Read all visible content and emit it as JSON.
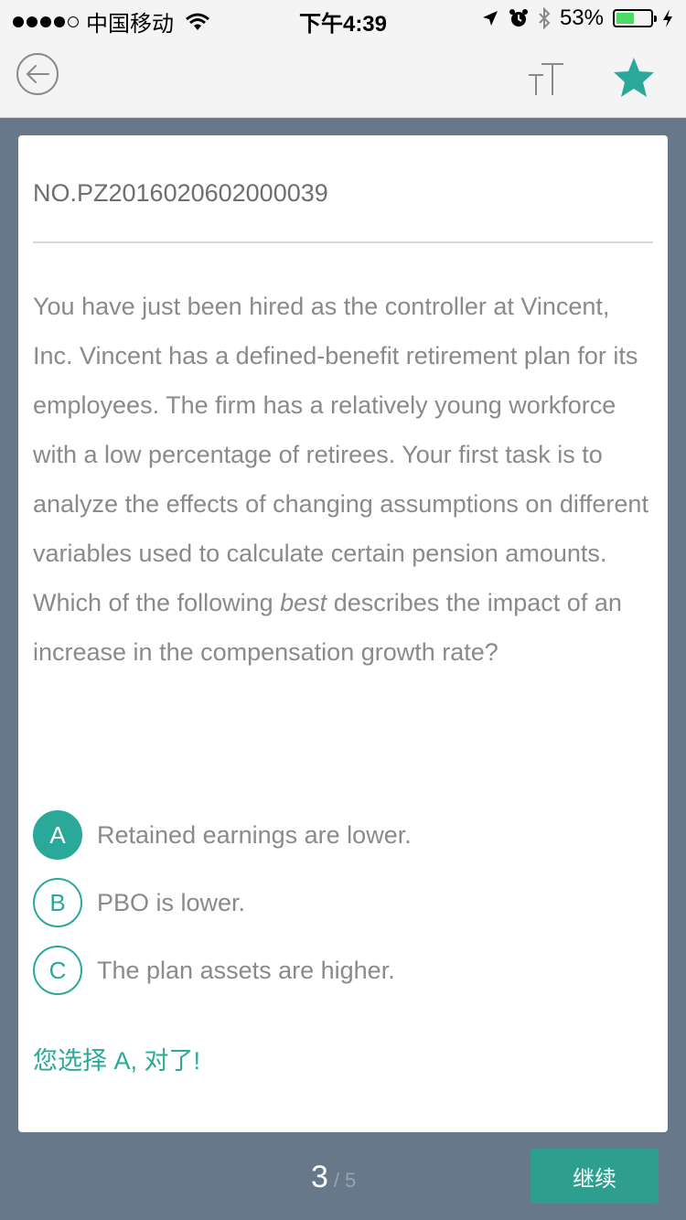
{
  "status_bar": {
    "carrier": "中国移动",
    "time": "下午4:39",
    "battery": "53%"
  },
  "question": {
    "id": "NO.PZ2016020602000039",
    "stem": "You have just been hired as the controller at Vincent, Inc. Vincent has a defined-benefit retirement plan for its employees. The firm has a relatively young workforce with a low percentage of retirees. Your first task is to analyze the effects of changing assumptions on different variables used to calculate certain pension amounts.",
    "prompt_before": "Which of the following ",
    "prompt_emphasis": "best",
    "prompt_after": " describes the impact of an increase in the compensation growth rate?",
    "options": [
      {
        "letter": "A",
        "text": "Retained earnings are lower."
      },
      {
        "letter": "B",
        "text": "PBO is lower."
      },
      {
        "letter": "C",
        "text": "The plan assets are higher."
      }
    ],
    "selected": "A",
    "result_text": "您选择 A, 对了!"
  },
  "footer": {
    "current_page": "3",
    "separator": "/",
    "total_pages": "5",
    "continue_label": "继续"
  },
  "colors": {
    "accent": "#2aa99a",
    "background": "#667889"
  }
}
